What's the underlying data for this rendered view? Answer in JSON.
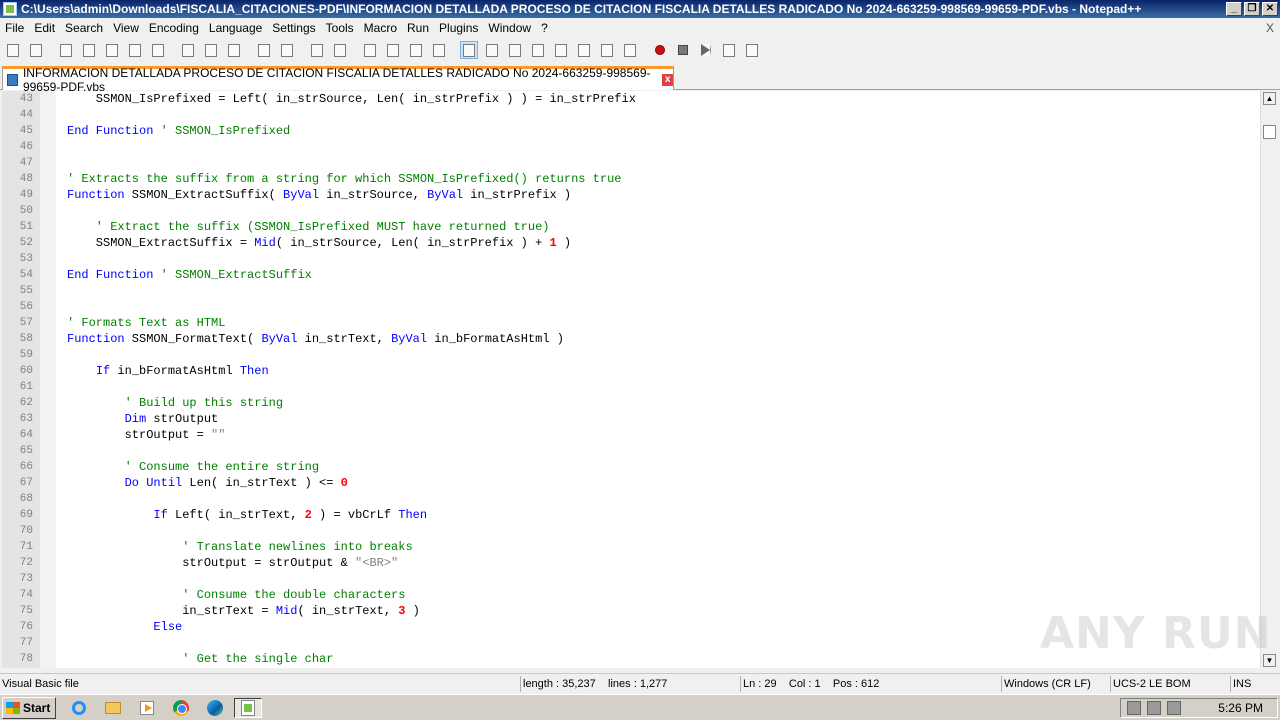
{
  "window": {
    "title": "C:\\Users\\admin\\Downloads\\FISCALIA_CITACIONES-PDF\\INFORMACION DETALLADA PROCESO DE CITACION FISCALIA DETALLES RADICADO No 2024-663259-998569-99659-PDF.vbs - Notepad++",
    "minimize": "_",
    "restore": "❐",
    "close": "✕"
  },
  "menu": {
    "items": [
      "File",
      "Edit",
      "Search",
      "View",
      "Encoding",
      "Language",
      "Settings",
      "Tools",
      "Macro",
      "Run",
      "Plugins",
      "Window",
      "?"
    ],
    "close": "X"
  },
  "toolbar": {
    "icons": [
      "new-file-icon",
      "open-file-icon",
      "save-icon",
      "save-all-icon",
      "close-icon",
      "close-all-icon",
      "print-icon",
      "cut-icon",
      "copy-icon",
      "paste-icon",
      "undo-icon",
      "redo-icon",
      "find-icon",
      "replace-icon",
      "zoom-in-icon",
      "zoom-out-icon",
      "sync-vertical-icon",
      "sync-horizontal-icon",
      "word-wrap-icon",
      "show-all-chars-icon",
      "indent-guide-icon",
      "language-icon",
      "doc-map-icon",
      "function-list-icon",
      "folder-workspace-icon",
      "monitoring-icon",
      "record-macro-icon",
      "stop-recording-icon",
      "playback-macro-icon",
      "run-macro-multiple-icon",
      "save-macro-icon"
    ]
  },
  "tab": {
    "label": "INFORMACION DETALLADA PROCESO DE CITACION FISCALIA DETALLES RADICADO No 2024-663259-998569-99659-PDF.vbs"
  },
  "editor": {
    "lines": [
      {
        "n": "43",
        "segs": [
          {
            "t": "    SSMON_IsPrefixed = Left( in_strSource, Len( in_strPrefix ) ) = in_strPrefix",
            "c": ""
          }
        ]
      },
      {
        "n": "44",
        "segs": []
      },
      {
        "n": "45",
        "segs": [
          {
            "t": "End Function",
            "c": "kw"
          },
          {
            "t": " ' SSMON_IsPrefixed",
            "c": "cm"
          }
        ]
      },
      {
        "n": "46",
        "segs": []
      },
      {
        "n": "47",
        "segs": []
      },
      {
        "n": "48",
        "segs": [
          {
            "t": "' Extracts the suffix from a string for which SSMON_IsPrefixed() returns true",
            "c": "cm"
          }
        ]
      },
      {
        "n": "49",
        "segs": [
          {
            "t": "Function",
            "c": "kw"
          },
          {
            "t": " SSMON_ExtractSuffix( ",
            "c": ""
          },
          {
            "t": "ByVal",
            "c": "kw"
          },
          {
            "t": " in_strSource, ",
            "c": ""
          },
          {
            "t": "ByVal",
            "c": "kw"
          },
          {
            "t": " in_strPrefix )",
            "c": ""
          }
        ]
      },
      {
        "n": "50",
        "segs": []
      },
      {
        "n": "51",
        "segs": [
          {
            "t": "    ' Extract the suffix (SSMON_IsPrefixed MUST have returned true)",
            "c": "cm"
          }
        ]
      },
      {
        "n": "52",
        "segs": [
          {
            "t": "    SSMON_ExtractSuffix = ",
            "c": ""
          },
          {
            "t": "Mid",
            "c": "kw"
          },
          {
            "t": "( in_strSource, Len( in_strPrefix ) + ",
            "c": ""
          },
          {
            "t": "1",
            "c": "num"
          },
          {
            "t": " )",
            "c": ""
          }
        ]
      },
      {
        "n": "53",
        "segs": []
      },
      {
        "n": "54",
        "segs": [
          {
            "t": "End Function",
            "c": "kw"
          },
          {
            "t": " ' SSMON_ExtractSuffix",
            "c": "cm"
          }
        ]
      },
      {
        "n": "55",
        "segs": []
      },
      {
        "n": "56",
        "segs": []
      },
      {
        "n": "57",
        "segs": [
          {
            "t": "' Formats Text as HTML",
            "c": "cm"
          }
        ]
      },
      {
        "n": "58",
        "segs": [
          {
            "t": "Function",
            "c": "kw"
          },
          {
            "t": " SSMON_FormatText( ",
            "c": ""
          },
          {
            "t": "ByVal",
            "c": "kw"
          },
          {
            "t": " in_strText, ",
            "c": ""
          },
          {
            "t": "ByVal",
            "c": "kw"
          },
          {
            "t": " in_bFormatAsHtml )",
            "c": ""
          }
        ]
      },
      {
        "n": "59",
        "segs": []
      },
      {
        "n": "60",
        "segs": [
          {
            "t": "    ",
            "c": ""
          },
          {
            "t": "If",
            "c": "kw"
          },
          {
            "t": " in_bFormatAsHtml ",
            "c": ""
          },
          {
            "t": "Then",
            "c": "kw"
          }
        ]
      },
      {
        "n": "61",
        "segs": []
      },
      {
        "n": "62",
        "segs": [
          {
            "t": "        ' Build up this string",
            "c": "cm"
          }
        ]
      },
      {
        "n": "63",
        "segs": [
          {
            "t": "        ",
            "c": ""
          },
          {
            "t": "Dim",
            "c": "kw"
          },
          {
            "t": " strOutput",
            "c": ""
          }
        ]
      },
      {
        "n": "64",
        "segs": [
          {
            "t": "        strOutput = ",
            "c": ""
          },
          {
            "t": "\"\"",
            "c": "str"
          }
        ]
      },
      {
        "n": "65",
        "segs": []
      },
      {
        "n": "66",
        "segs": [
          {
            "t": "        ' Consume the entire string",
            "c": "cm"
          }
        ]
      },
      {
        "n": "67",
        "segs": [
          {
            "t": "        ",
            "c": ""
          },
          {
            "t": "Do Until",
            "c": "kw"
          },
          {
            "t": " Len( in_strText ) <= ",
            "c": ""
          },
          {
            "t": "0",
            "c": "num"
          }
        ]
      },
      {
        "n": "68",
        "segs": []
      },
      {
        "n": "69",
        "segs": [
          {
            "t": "            ",
            "c": ""
          },
          {
            "t": "If",
            "c": "kw"
          },
          {
            "t": " Left( in_strText, ",
            "c": ""
          },
          {
            "t": "2",
            "c": "num"
          },
          {
            "t": " ) = vbCrLf ",
            "c": ""
          },
          {
            "t": "Then",
            "c": "kw"
          }
        ]
      },
      {
        "n": "70",
        "segs": []
      },
      {
        "n": "71",
        "segs": [
          {
            "t": "                ' Translate newlines into breaks",
            "c": "cm"
          }
        ]
      },
      {
        "n": "72",
        "segs": [
          {
            "t": "                strOutput = strOutput & ",
            "c": ""
          },
          {
            "t": "\"<BR>\"",
            "c": "str"
          }
        ]
      },
      {
        "n": "73",
        "segs": []
      },
      {
        "n": "74",
        "segs": [
          {
            "t": "                ' Consume the double characters",
            "c": "cm"
          }
        ]
      },
      {
        "n": "75",
        "segs": [
          {
            "t": "                in_strText = ",
            "c": ""
          },
          {
            "t": "Mid",
            "c": "kw"
          },
          {
            "t": "( in_strText, ",
            "c": ""
          },
          {
            "t": "3",
            "c": "num"
          },
          {
            "t": " )",
            "c": ""
          }
        ]
      },
      {
        "n": "76",
        "segs": [
          {
            "t": "            ",
            "c": ""
          },
          {
            "t": "Else",
            "c": "kw"
          }
        ]
      },
      {
        "n": "77",
        "segs": []
      },
      {
        "n": "78",
        "segs": [
          {
            "t": "                ' Get the single char",
            "c": "cm"
          }
        ]
      }
    ]
  },
  "status": {
    "language": "Visual Basic file",
    "length": "length : 35,237",
    "lines": "lines : 1,277",
    "ln": "Ln : 29",
    "col": "Col : 1",
    "pos": "Pos : 612",
    "eol": "Windows (CR LF)",
    "encoding": "UCS-2 LE BOM",
    "mode": "INS"
  },
  "taskbar": {
    "start": "Start",
    "apps": [
      "internet-explorer-icon",
      "file-explorer-icon",
      "media-player-icon",
      "chrome-icon",
      "edge-icon",
      "notepad-plus-plus-icon"
    ],
    "clock": "5:26 PM"
  },
  "watermark": "ANY RUN"
}
